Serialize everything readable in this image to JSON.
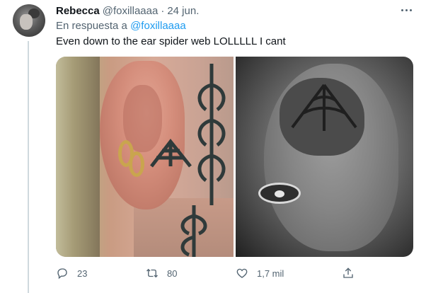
{
  "tweet": {
    "author": {
      "display_name": "Rebecca",
      "handle": "@foxillaaaa",
      "separator": "·",
      "date": "24 jun."
    },
    "reply_prefix": "En respuesta a",
    "reply_to": "@foxillaaaa",
    "text": "Even down to the ear spider web LOLLLLL I cant",
    "media_count": 2,
    "actions": {
      "replies": "23",
      "retweets": "80",
      "likes": "1,7 mil"
    }
  },
  "colors": {
    "accent": "#1d9bf0",
    "secondary_text": "#536471",
    "primary_text": "#0f1419",
    "thread_line": "#cfd9de"
  },
  "icons": [
    "more-icon",
    "reply-icon",
    "retweet-icon",
    "like-icon",
    "share-icon"
  ]
}
